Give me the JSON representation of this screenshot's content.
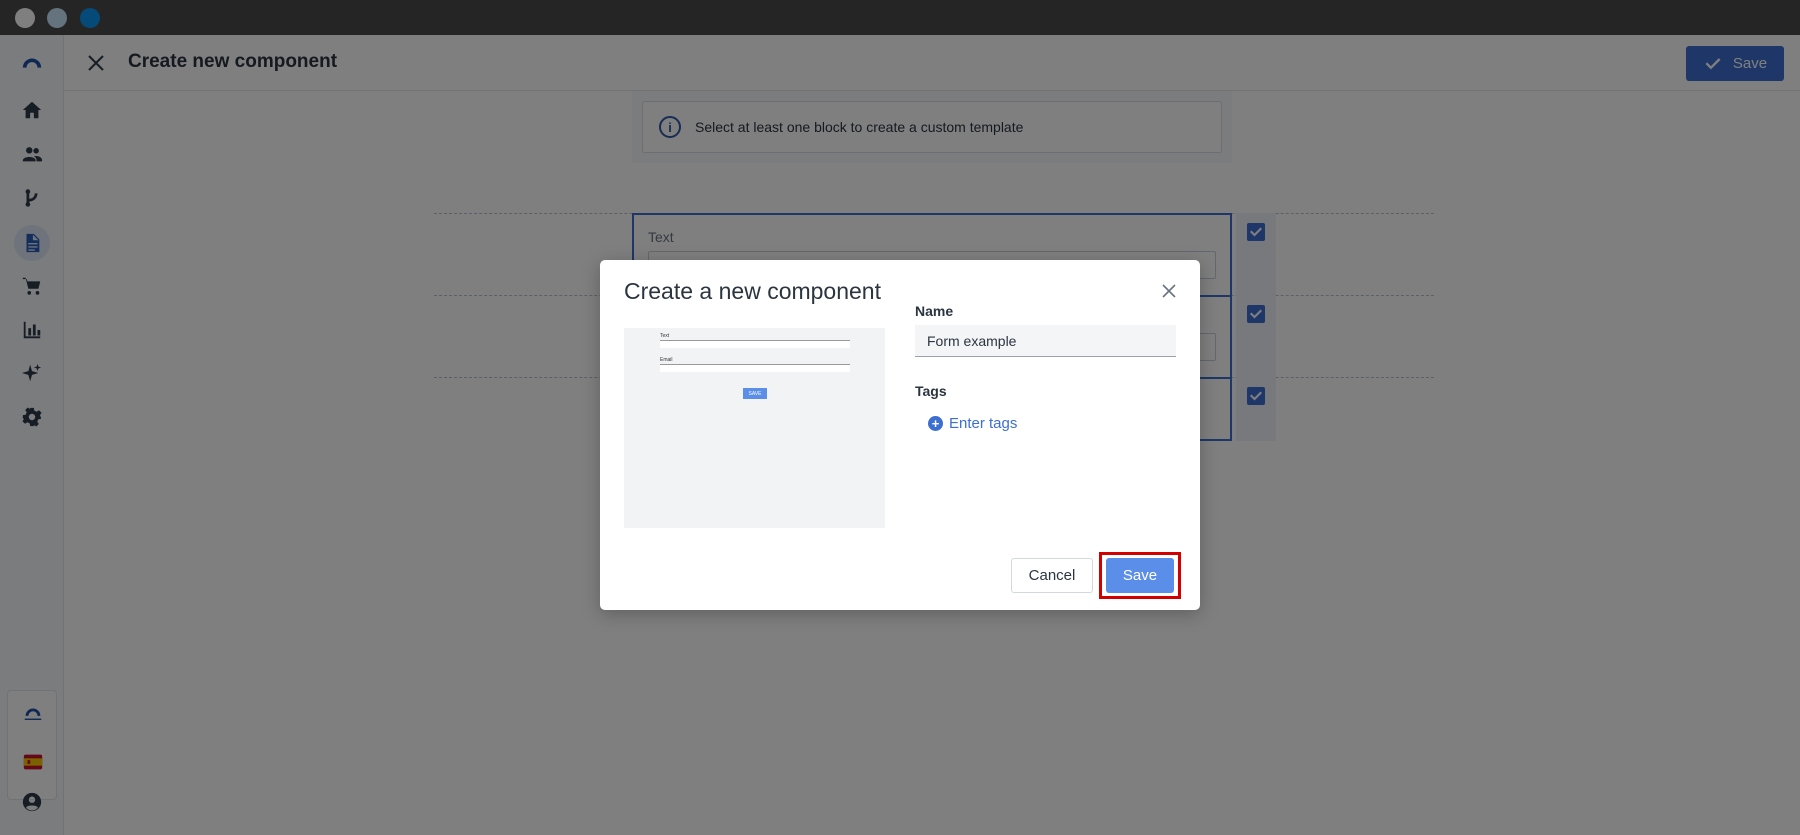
{
  "header": {
    "title": "Create new component",
    "save_label": "Save"
  },
  "sidebar": {
    "items": [
      {
        "icon": "home-icon"
      },
      {
        "icon": "users-icon"
      },
      {
        "icon": "flow-icon"
      },
      {
        "icon": "document-icon",
        "active": true
      },
      {
        "icon": "cart-icon"
      },
      {
        "icon": "chart-icon"
      },
      {
        "icon": "sparkles-icon"
      },
      {
        "icon": "gear-icon"
      }
    ]
  },
  "canvas": {
    "info_text": "Select at least one block to create a custom template",
    "block_label": "Text"
  },
  "modal": {
    "title": "Create a new component",
    "name_label": "Name",
    "name_value": "Form example",
    "tags_label": "Tags",
    "enter_tags": "Enter tags",
    "cancel_label": "Cancel",
    "save_label": "Save"
  },
  "colors": {
    "accent": "#3c6fd0",
    "save_button": "#5b8ee8",
    "highlight": "#d40000"
  }
}
